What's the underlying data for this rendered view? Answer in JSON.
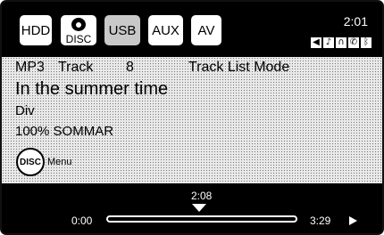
{
  "sources": [
    {
      "label": "HDD",
      "active": false
    },
    {
      "label": "DISC",
      "active": false
    },
    {
      "label": "USB",
      "active": true
    },
    {
      "label": "AUX",
      "active": false
    },
    {
      "label": "AV",
      "active": false
    }
  ],
  "status": {
    "clock": "2:01",
    "icons": [
      "phone-volume-icon",
      "music-phone-icon",
      "headset-icon",
      "phone-icon",
      "bluetooth-icon"
    ]
  },
  "info": {
    "format": "MP3",
    "track_word": "Track",
    "track_number": "8",
    "mode": "Track List Mode",
    "title": "In the summer time",
    "artist": "Div",
    "album": "100% SOMMAR",
    "disc_button": "DISC",
    "menu_label": "Menu"
  },
  "progress": {
    "current": "2:08",
    "start": "0:00",
    "end": "3:29",
    "fraction": 0.5
  }
}
